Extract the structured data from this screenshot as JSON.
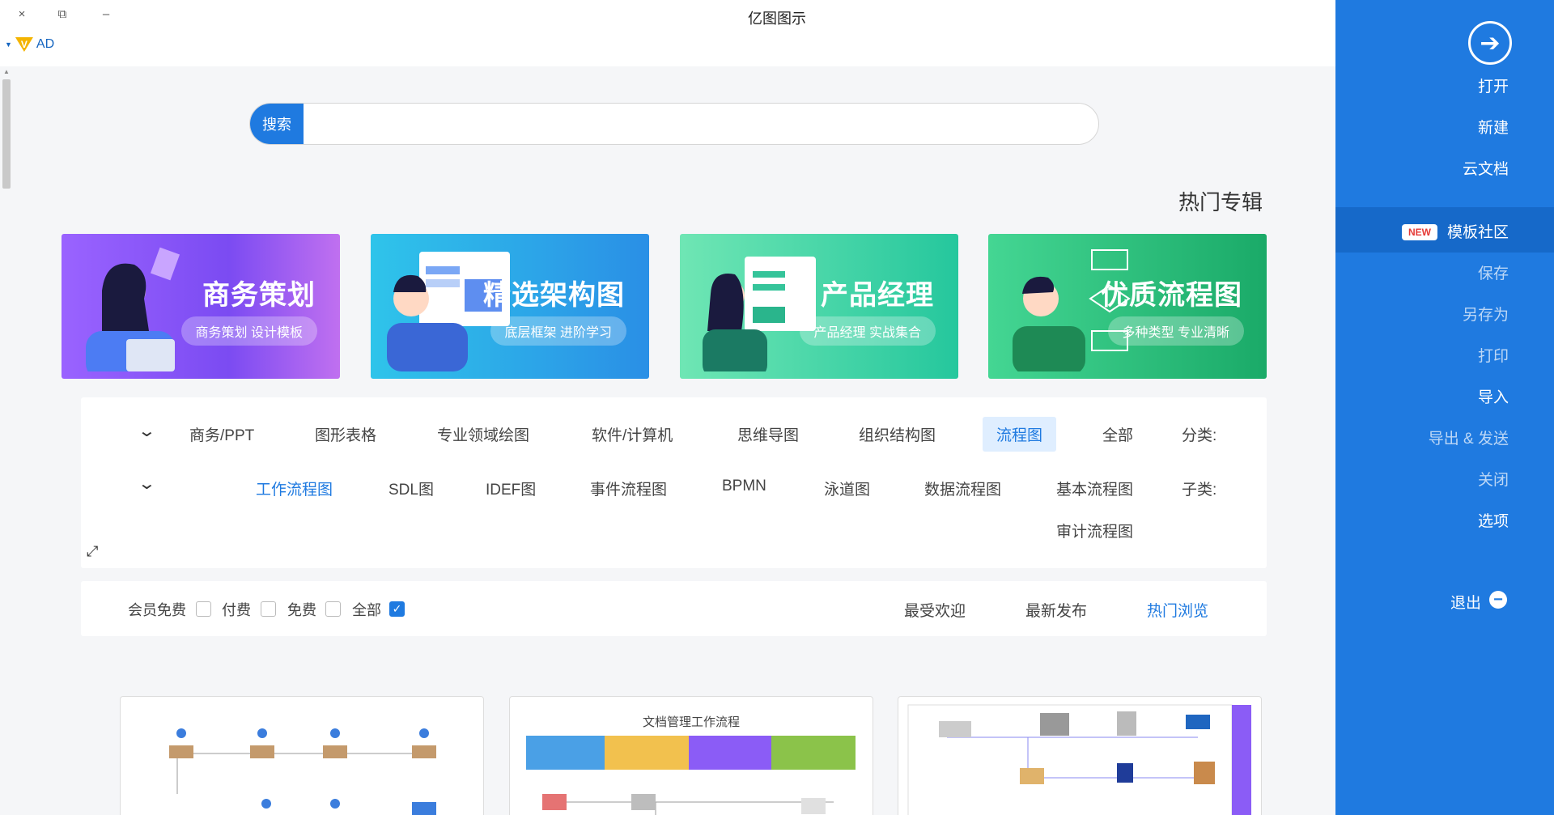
{
  "window": {
    "title": "亿图图示",
    "close_icon": "×",
    "restore_icon": "⧉",
    "minimize_icon": "–"
  },
  "account": {
    "name": "AD",
    "badge": "V"
  },
  "search": {
    "button_label": "搜索",
    "placeholder": ""
  },
  "hot_section": {
    "title": "热门专辑"
  },
  "banners": [
    {
      "title": "优质流程图",
      "subtitle": "多种类型 专业清晰",
      "color_from": "#3fd08a",
      "color_to": "#1aa968"
    },
    {
      "title": "产品经理",
      "subtitle": "产品经理 实战集合",
      "color_from": "#6ee3b0",
      "color_to": "#1fc39a"
    },
    {
      "title": "精选架构图",
      "subtitle": "底层框架 进阶学习",
      "color_from": "#2cc0e8",
      "color_to": "#2a8fe6"
    },
    {
      "title": "商务策划",
      "subtitle": "商务策划 设计模板",
      "color_from": "#8f5bff",
      "color_to": "#c06bf5"
    }
  ],
  "filters": {
    "category_label": "分类:",
    "categories": [
      "全部",
      "流程图",
      "组织结构图",
      "思维导图",
      "软件/计算机",
      "专业领域绘图",
      "图形表格",
      "商务/PPT"
    ],
    "selected_category": "流程图",
    "subcategory_label": "子类:",
    "subcategories": [
      "基本流程图",
      "数据流程图",
      "泳道图",
      "BPMN",
      "事件流程图",
      "IDEF图",
      "SDL图",
      "工作流程图",
      "审计流程图"
    ],
    "selected_subcategory": "工作流程图"
  },
  "sort": {
    "options": [
      "热门浏览",
      "最新发布",
      "最受欢迎"
    ],
    "selected": "热门浏览",
    "price_filters": [
      {
        "label": "全部",
        "checked": true
      },
      {
        "label": "免费",
        "checked": false
      },
      {
        "label": "付费",
        "checked": false
      },
      {
        "label": "会员免费",
        "checked": false
      }
    ]
  },
  "cards": [
    {
      "title": ""
    },
    {
      "title": "文档管理工作流程"
    },
    {
      "title": ""
    }
  ],
  "sidebar": {
    "items": [
      {
        "label": "打开",
        "active": true
      },
      {
        "label": "新建",
        "active": true
      },
      {
        "label": "云文档",
        "active": true
      },
      {
        "label": "模板社区",
        "active": true,
        "selected": true,
        "badge": "NEW"
      },
      {
        "label": "保存",
        "active": false
      },
      {
        "label": "另存为",
        "active": false
      },
      {
        "label": "打印",
        "active": false
      },
      {
        "label": "导入",
        "active": true
      },
      {
        "label": "导出 & 发送",
        "active": false
      },
      {
        "label": "关闭",
        "active": false
      },
      {
        "label": "选项",
        "active": true
      },
      {
        "label": "退出",
        "active": true
      }
    ]
  },
  "colors": {
    "accent": "#1f7ae0",
    "sidebar": "#1f7ae0",
    "sidebar_selected": "#1669c9",
    "new_badge": "#e53935"
  }
}
